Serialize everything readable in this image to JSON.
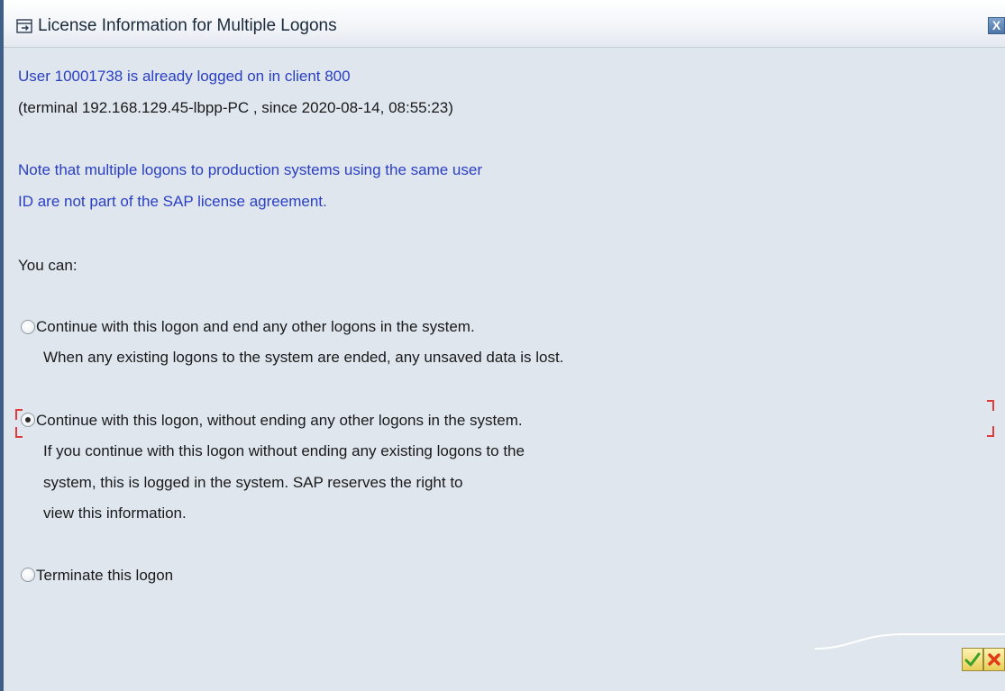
{
  "window": {
    "title": "License Information for Multiple Logons",
    "close_glyph": "X"
  },
  "message": {
    "user_line": "User 10001738 is already logged on in client 800",
    "terminal_line": "(terminal 192.168.129.45-lbpp-PC , since 2020-08-14, 08:55:23)",
    "note_line_1": "Note that multiple logons to production systems using the same user",
    "note_line_2": "ID are not part of the SAP license agreement.",
    "you_can": "You can:"
  },
  "options": [
    {
      "label": "Continue with this logon and end any other logons in the system.",
      "detail": [
        "When any existing logons to the system are ended, any unsaved data is lost."
      ],
      "selected": false
    },
    {
      "label": "Continue with this logon, without ending any other logons in the system.",
      "detail": [
        "If you continue with this logon without ending any existing logons to the",
        "system, this is logged in the system. SAP reserves the right to",
        "view this information."
      ],
      "selected": true
    },
    {
      "label": "Terminate this logon",
      "detail": [],
      "selected": false
    }
  ],
  "buttons": {
    "confirm_icon": "checkmark-icon",
    "cancel_icon": "cancel-x-icon"
  },
  "colors": {
    "info_text": "#2a3fc2",
    "focus_bracket": "#e23b3b",
    "confirm": "#3aa02a",
    "cancel": "#e03a1a"
  }
}
